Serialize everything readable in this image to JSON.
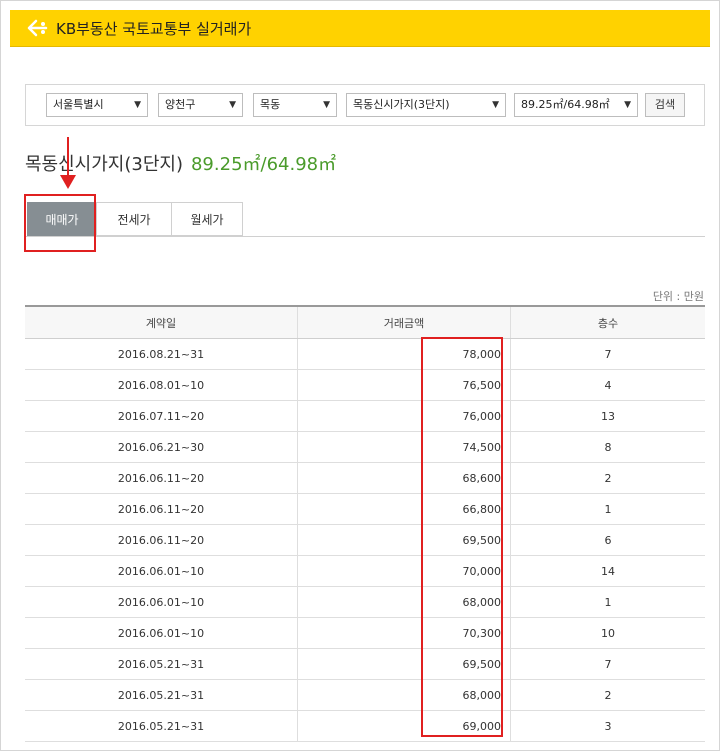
{
  "header": {
    "title": "KB부동산 국토교통부 실거래가"
  },
  "filters": [
    {
      "value": "서울특별시"
    },
    {
      "value": "양천구"
    },
    {
      "value": "목동"
    },
    {
      "value": "목동신시가지(3단지)"
    },
    {
      "value": "89.25㎡/64.98㎡"
    }
  ],
  "search_label": "검색",
  "page": {
    "title": "목동신시가지(3단지)",
    "area": "89.25㎡/64.98㎡"
  },
  "tabs": [
    {
      "label": "매매가"
    },
    {
      "label": "전세가"
    },
    {
      "label": "월세가"
    }
  ],
  "unit_note": "단위 : 만원",
  "table": {
    "headers": [
      "계약일",
      "거래금액",
      "층수"
    ],
    "rows": [
      [
        "2016.08.21~31",
        "78,000",
        "7"
      ],
      [
        "2016.08.01~10",
        "76,500",
        "4"
      ],
      [
        "2016.07.11~20",
        "76,000",
        "13"
      ],
      [
        "2016.06.21~30",
        "74,500",
        "8"
      ],
      [
        "2016.06.11~20",
        "68,600",
        "2"
      ],
      [
        "2016.06.11~20",
        "66,800",
        "1"
      ],
      [
        "2016.06.11~20",
        "69,500",
        "6"
      ],
      [
        "2016.06.01~10",
        "70,000",
        "14"
      ],
      [
        "2016.06.01~10",
        "68,000",
        "1"
      ],
      [
        "2016.06.01~10",
        "70,300",
        "10"
      ],
      [
        "2016.05.21~31",
        "69,500",
        "7"
      ],
      [
        "2016.05.21~31",
        "68,000",
        "2"
      ],
      [
        "2016.05.21~31",
        "69,000",
        "3"
      ]
    ]
  },
  "colors": {
    "header_bg": "#ffd200",
    "active_tab": "#868e93",
    "area_text": "#4a9b2b",
    "annotation": "#e02020"
  }
}
